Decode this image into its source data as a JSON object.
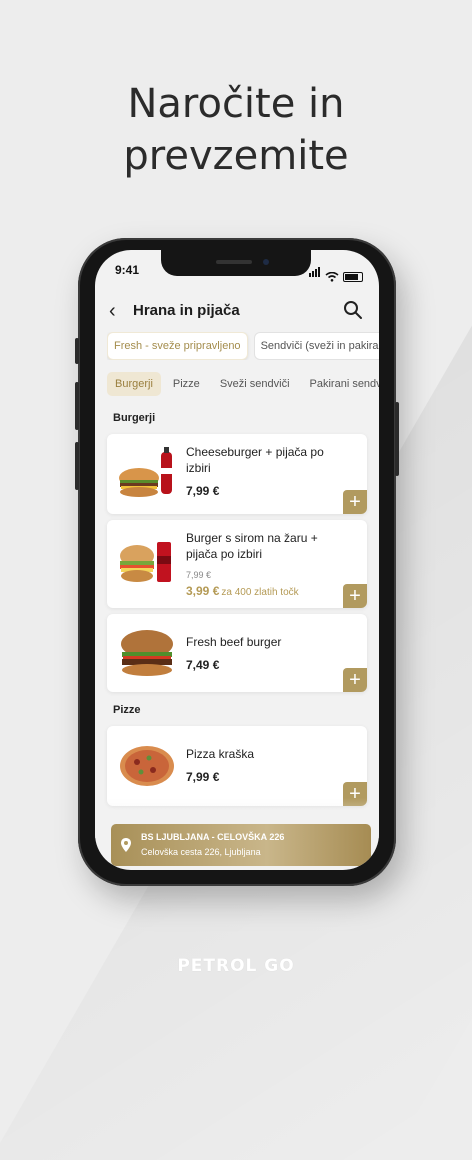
{
  "headline": {
    "line1": "Naročite in",
    "line2": "prevzemite"
  },
  "status": {
    "time": "9:41"
  },
  "header": {
    "title": "Hrana in pijača"
  },
  "chips": [
    {
      "label": "Fresh - sveže pripravljeno",
      "active": true
    },
    {
      "label": "Sendviči (sveži in pakira",
      "active": false
    }
  ],
  "tabs": [
    {
      "label": "Burgerji",
      "active": true
    },
    {
      "label": "Pizze"
    },
    {
      "label": "Sveži sendviči"
    },
    {
      "label": "Pakirani sendv"
    }
  ],
  "sections": [
    {
      "title": "Burgerji"
    },
    {
      "title": "Pizze"
    }
  ],
  "items": [
    {
      "name": "Cheeseburger + pijača po izbiri",
      "price": "7,99 €"
    },
    {
      "name": "Burger s sirom na žaru + pijača po izbiri",
      "old_price": "7,99 €",
      "promo_price": "3,99 €",
      "promo_note": "za 400 zlatih točk"
    },
    {
      "name": "Fresh beef burger",
      "price": "7,49 €"
    },
    {
      "name": "Pizza kraška",
      "price": "7,99 €"
    }
  ],
  "add_label": "+",
  "location": {
    "name": "BS LJUBLJANA - CELOVŠKA 226",
    "address": "Celovška cesta 226, Ljubljana"
  },
  "brand": "PETROL GO",
  "colors": {
    "accent": "#b19a5f",
    "background": "#ededed"
  }
}
